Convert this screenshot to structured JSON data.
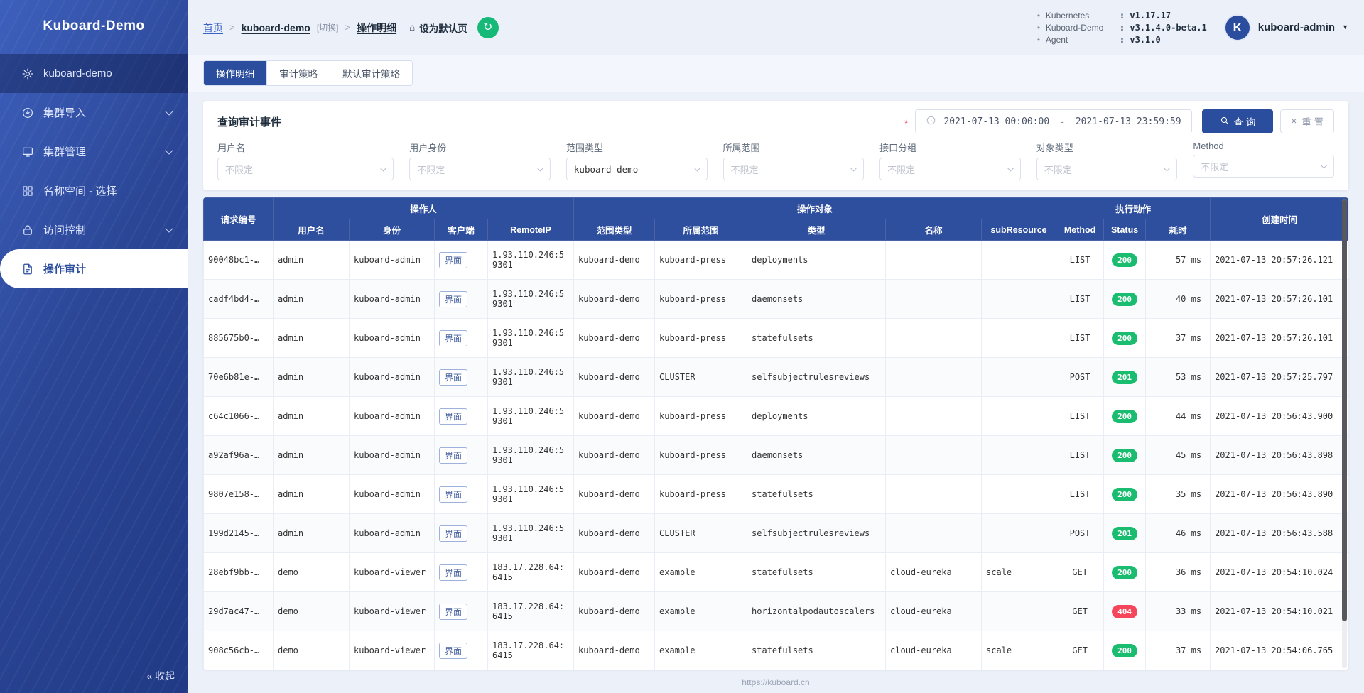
{
  "colors": {
    "accent": "#2b4d9e",
    "table_header": "#2e4f9e",
    "status_ok": "#1abd6f",
    "status_err": "#f5465c",
    "refresh_button": "#17b978",
    "sidebar_top": "#3d60bd",
    "sidebar_bottom": "#203a85"
  },
  "sidebar": {
    "title": "Kuboard-Demo",
    "items": [
      {
        "id": "kuboard-demo",
        "label": "kuboard-demo",
        "icon": "gear-icon",
        "selected": true
      },
      {
        "id": "cluster-import",
        "label": "集群导入",
        "icon": "import-icon",
        "chevron": true
      },
      {
        "id": "cluster-manage",
        "label": "集群管理",
        "icon": "monitor-icon",
        "chevron": true
      },
      {
        "id": "namespace-select",
        "label": "名称空间 - 选择",
        "icon": "grid-icon"
      },
      {
        "id": "access-control",
        "label": "访问控制",
        "icon": "lock-icon",
        "chevron": true
      },
      {
        "id": "operation-audit",
        "label": "操作审计",
        "icon": "audit-icon",
        "active": true
      }
    ],
    "collapse_label": "« 收起"
  },
  "header": {
    "breadcrumb": {
      "home": "首页",
      "cluster": "kuboard-demo",
      "switch_hint": "[切换]",
      "current": "操作明细"
    },
    "set_default_label": "设为默认页",
    "versions": [
      {
        "name": "Kubernetes",
        "value": "v1.17.17"
      },
      {
        "name": "Kuboard-Demo",
        "value": "v3.1.4.0-beta.1"
      },
      {
        "name": "Agent",
        "value": "v3.1.0"
      }
    ],
    "user": {
      "avatar_initial": "K",
      "name": "kuboard-admin"
    }
  },
  "tabs": [
    {
      "id": "audit-detail",
      "label": "操作明细",
      "active": true
    },
    {
      "id": "audit-policy",
      "label": "审计策略",
      "active": false
    },
    {
      "id": "default-audit-policy",
      "label": "默认审计策略",
      "active": false
    }
  ],
  "query": {
    "title": "查询审计事件",
    "required_mark": "*",
    "date_start": "2021-07-13 00:00:00",
    "date_separator": "-",
    "date_end": "2021-07-13 23:59:59",
    "search_label": "查 询",
    "reset_label": "重 置",
    "filters": [
      {
        "id": "user-name",
        "label": "用户名",
        "value": "不限定",
        "placeholder": true
      },
      {
        "id": "user-identity",
        "label": "用户身份",
        "value": "不限定",
        "placeholder": true
      },
      {
        "id": "scope-type",
        "label": "范围类型",
        "value": "kuboard-demo",
        "placeholder": false
      },
      {
        "id": "scope",
        "label": "所属范围",
        "value": "不限定",
        "placeholder": true
      },
      {
        "id": "api-group",
        "label": "接口分组",
        "value": "不限定",
        "placeholder": true
      },
      {
        "id": "object-type",
        "label": "对象类型",
        "value": "不限定",
        "placeholder": true
      },
      {
        "id": "method",
        "label": "Method",
        "value": "不限定",
        "placeholder": true
      }
    ]
  },
  "table": {
    "groups": {
      "request_id": "请求编号",
      "operator": "操作人",
      "target": "操作对象",
      "action": "执行动作",
      "created_at": "创建时间"
    },
    "columns": [
      "用户名",
      "身份",
      "客户端",
      "RemoteIP",
      "范围类型",
      "所属范围",
      "类型",
      "名称",
      "subResource",
      "Method",
      "Status",
      "耗时"
    ],
    "rows": [
      {
        "id": "90048bc1-…",
        "user": "admin",
        "identity": "kuboard-admin",
        "client": "界面",
        "remote_ip": "1.93.110.246:59301",
        "scope_type": "kuboard-demo",
        "scope": "kuboard-press",
        "type": "deployments",
        "name": "",
        "sub_resource": "",
        "method": "LIST",
        "status": "200",
        "duration": "57 ms",
        "created_at": "2021-07-13 20:57:26.121"
      },
      {
        "id": "cadf4bd4-…",
        "user": "admin",
        "identity": "kuboard-admin",
        "client": "界面",
        "remote_ip": "1.93.110.246:59301",
        "scope_type": "kuboard-demo",
        "scope": "kuboard-press",
        "type": "daemonsets",
        "name": "",
        "sub_resource": "",
        "method": "LIST",
        "status": "200",
        "duration": "40 ms",
        "created_at": "2021-07-13 20:57:26.101"
      },
      {
        "id": "885675b0-…",
        "user": "admin",
        "identity": "kuboard-admin",
        "client": "界面",
        "remote_ip": "1.93.110.246:59301",
        "scope_type": "kuboard-demo",
        "scope": "kuboard-press",
        "type": "statefulsets",
        "name": "",
        "sub_resource": "",
        "method": "LIST",
        "status": "200",
        "duration": "37 ms",
        "created_at": "2021-07-13 20:57:26.101"
      },
      {
        "id": "70e6b81e-…",
        "user": "admin",
        "identity": "kuboard-admin",
        "client": "界面",
        "remote_ip": "1.93.110.246:59301",
        "scope_type": "kuboard-demo",
        "scope": "CLUSTER",
        "type": "selfsubjectrulesreviews",
        "name": "",
        "sub_resource": "",
        "method": "POST",
        "status": "201",
        "duration": "53 ms",
        "created_at": "2021-07-13 20:57:25.797"
      },
      {
        "id": "c64c1066-…",
        "user": "admin",
        "identity": "kuboard-admin",
        "client": "界面",
        "remote_ip": "1.93.110.246:59301",
        "scope_type": "kuboard-demo",
        "scope": "kuboard-press",
        "type": "deployments",
        "name": "",
        "sub_resource": "",
        "method": "LIST",
        "status": "200",
        "duration": "44 ms",
        "created_at": "2021-07-13 20:56:43.900"
      },
      {
        "id": "a92af96a-…",
        "user": "admin",
        "identity": "kuboard-admin",
        "client": "界面",
        "remote_ip": "1.93.110.246:59301",
        "scope_type": "kuboard-demo",
        "scope": "kuboard-press",
        "type": "daemonsets",
        "name": "",
        "sub_resource": "",
        "method": "LIST",
        "status": "200",
        "duration": "45 ms",
        "created_at": "2021-07-13 20:56:43.898"
      },
      {
        "id": "9807e158-…",
        "user": "admin",
        "identity": "kuboard-admin",
        "client": "界面",
        "remote_ip": "1.93.110.246:59301",
        "scope_type": "kuboard-demo",
        "scope": "kuboard-press",
        "type": "statefulsets",
        "name": "",
        "sub_resource": "",
        "method": "LIST",
        "status": "200",
        "duration": "35 ms",
        "created_at": "2021-07-13 20:56:43.890"
      },
      {
        "id": "199d2145-…",
        "user": "admin",
        "identity": "kuboard-admin",
        "client": "界面",
        "remote_ip": "1.93.110.246:59301",
        "scope_type": "kuboard-demo",
        "scope": "CLUSTER",
        "type": "selfsubjectrulesreviews",
        "name": "",
        "sub_resource": "",
        "method": "POST",
        "status": "201",
        "duration": "46 ms",
        "created_at": "2021-07-13 20:56:43.588"
      },
      {
        "id": "28ebf9bb-…",
        "user": "demo",
        "identity": "kuboard-viewer",
        "client": "界面",
        "remote_ip": "183.17.228.64:6415",
        "scope_type": "kuboard-demo",
        "scope": "example",
        "type": "statefulsets",
        "name": "cloud-eureka",
        "sub_resource": "scale",
        "method": "GET",
        "status": "200",
        "duration": "36 ms",
        "created_at": "2021-07-13 20:54:10.024"
      },
      {
        "id": "29d7ac47-…",
        "user": "demo",
        "identity": "kuboard-viewer",
        "client": "界面",
        "remote_ip": "183.17.228.64:6415",
        "scope_type": "kuboard-demo",
        "scope": "example",
        "type": "horizontalpodautoscalers",
        "name": "cloud-eureka",
        "sub_resource": "",
        "method": "GET",
        "status": "404",
        "duration": "33 ms",
        "created_at": "2021-07-13 20:54:10.021"
      },
      {
        "id": "908c56cb-…",
        "user": "demo",
        "identity": "kuboard-viewer",
        "client": "界面",
        "remote_ip": "183.17.228.64:6415",
        "scope_type": "kuboard-demo",
        "scope": "example",
        "type": "statefulsets",
        "name": "cloud-eureka",
        "sub_resource": "scale",
        "method": "GET",
        "status": "200",
        "duration": "37 ms",
        "created_at": "2021-07-13 20:54:06.765"
      }
    ]
  },
  "footer": {
    "link": "https://kuboard.cn"
  }
}
